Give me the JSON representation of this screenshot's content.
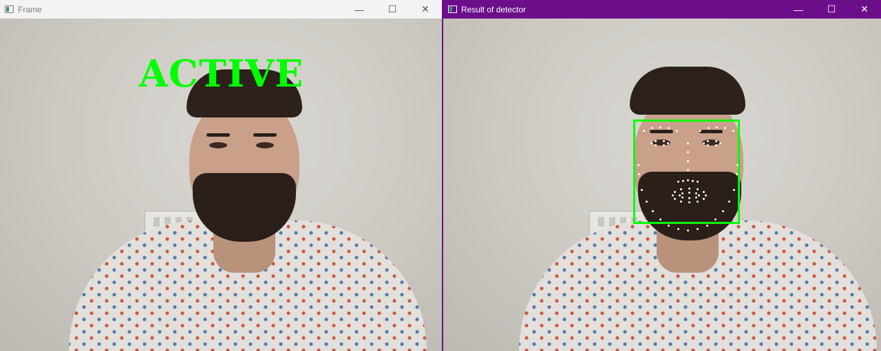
{
  "windows": {
    "frame": {
      "title": "Frame",
      "controls": {
        "minimize": "—",
        "maximize": "☐",
        "close": "✕"
      },
      "status_label": "ACTIVE"
    },
    "detector": {
      "title": "Result of detector",
      "controls": {
        "minimize": "—",
        "maximize": "☐",
        "close": "✕"
      }
    }
  },
  "colors": {
    "detector_titlebar": "#6c0e8a",
    "overlay_green": "#00ff00",
    "landmark": "#ffffff"
  }
}
